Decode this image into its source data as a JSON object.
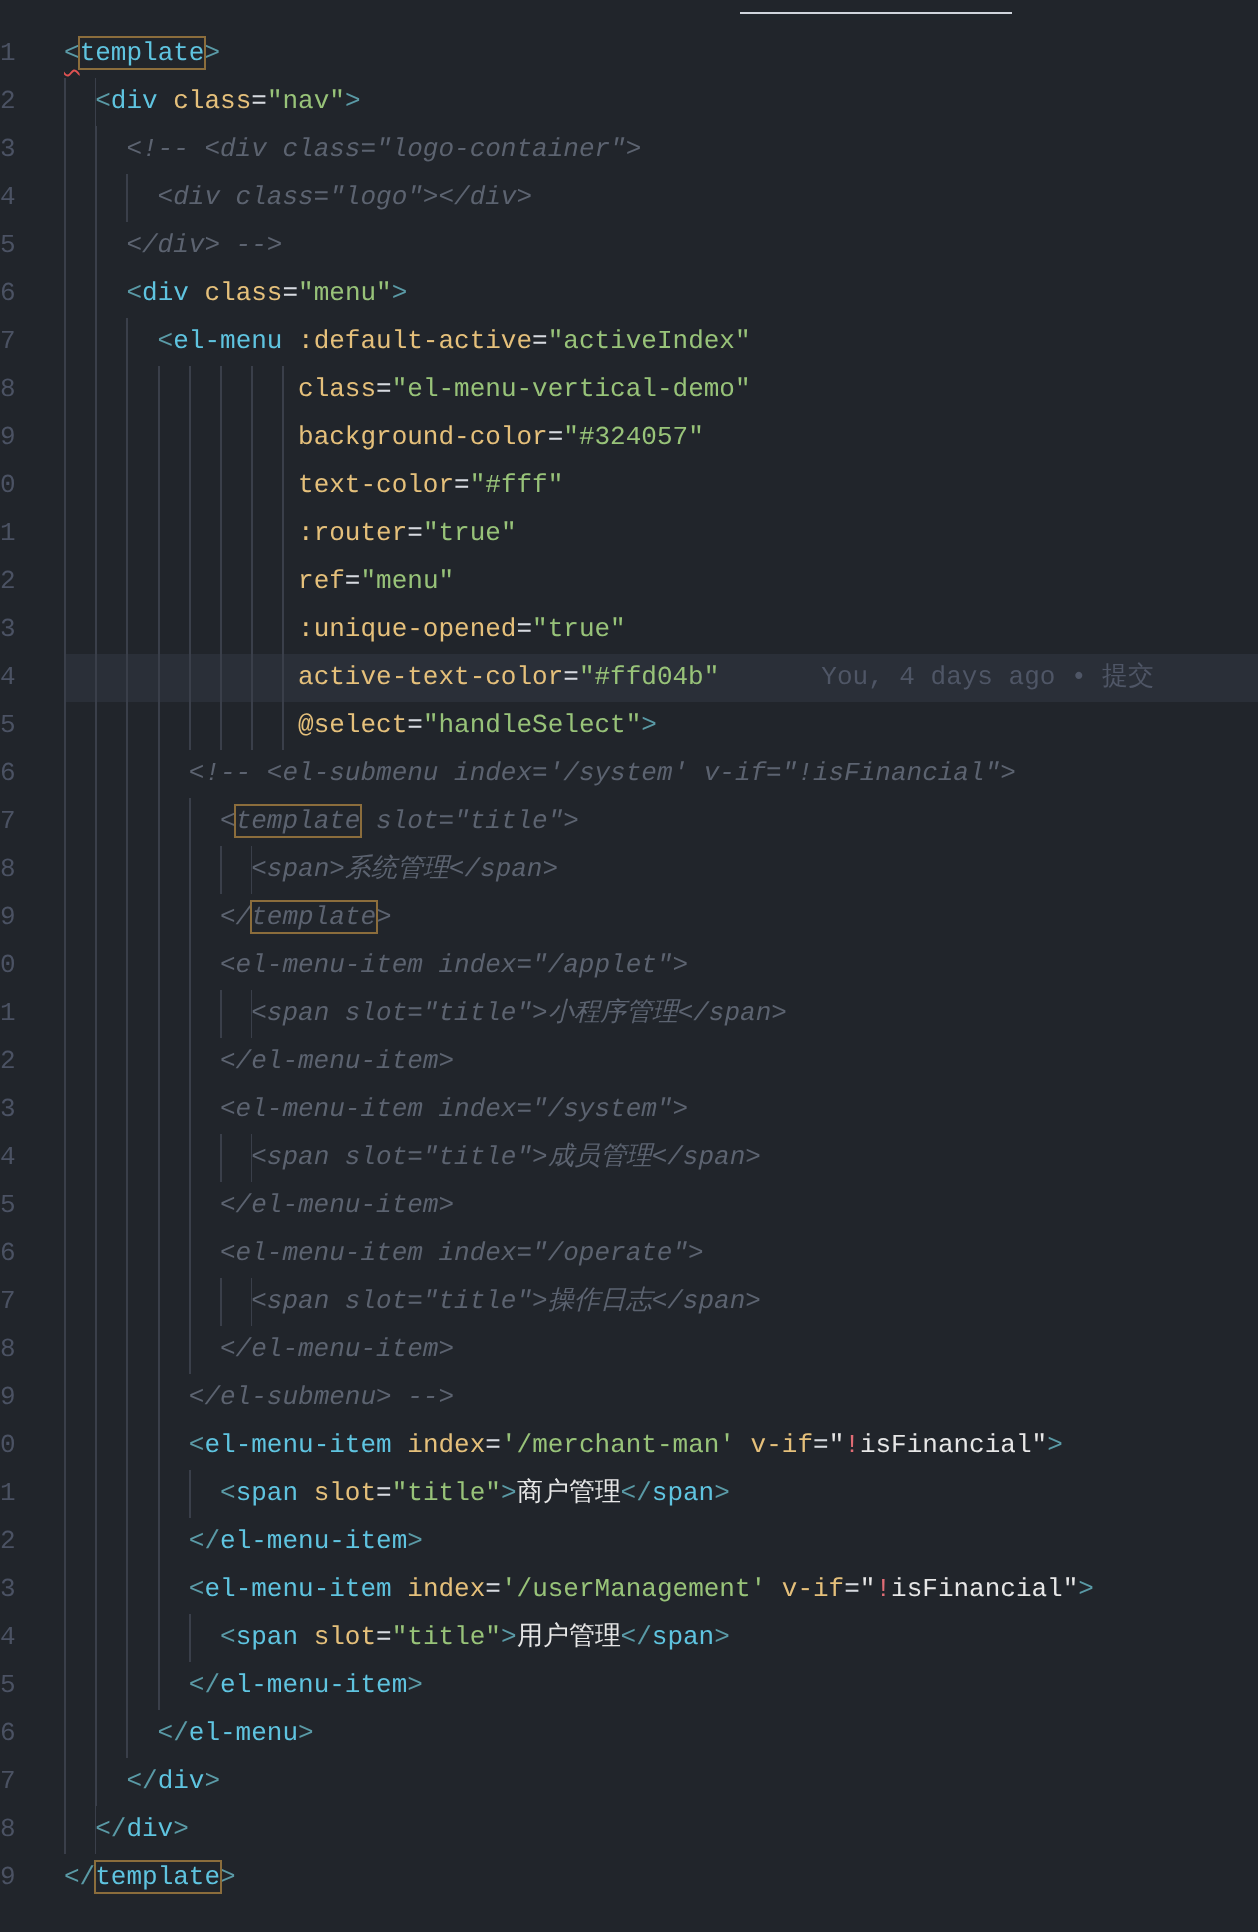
{
  "editor": {
    "lines": [
      {
        "number": "1",
        "highlighted": false,
        "tokens": [
          {
            "kind": "bracket-error",
            "text": "<"
          },
          {
            "kind": "tag-match",
            "text": "template"
          },
          {
            "kind": "bracket",
            "text": ">"
          }
        ]
      },
      {
        "number": "2",
        "highlighted": false,
        "tokens": [
          {
            "kind": "bracket",
            "text": "  <"
          },
          {
            "kind": "tag",
            "text": "div"
          },
          {
            "kind": "attr",
            "text": " class"
          },
          {
            "kind": "eq",
            "text": "="
          },
          {
            "kind": "str",
            "text": "\"nav\""
          },
          {
            "kind": "bracket",
            "text": ">"
          }
        ]
      },
      {
        "number": "3",
        "highlighted": false,
        "tokens": [
          {
            "kind": "comment",
            "text": "    <!-- <div class=\"logo-container\">"
          }
        ]
      },
      {
        "number": "4",
        "highlighted": false,
        "tokens": [
          {
            "kind": "comment",
            "text": "      <div class=\"logo\"></div>"
          }
        ]
      },
      {
        "number": "5",
        "highlighted": false,
        "tokens": [
          {
            "kind": "comment",
            "text": "    </div> -->"
          }
        ]
      },
      {
        "number": "6",
        "highlighted": false,
        "tokens": [
          {
            "kind": "bracket",
            "text": "    <"
          },
          {
            "kind": "tag",
            "text": "div"
          },
          {
            "kind": "attr",
            "text": " class"
          },
          {
            "kind": "eq",
            "text": "="
          },
          {
            "kind": "str",
            "text": "\"menu\""
          },
          {
            "kind": "bracket",
            "text": ">"
          }
        ]
      },
      {
        "number": "7",
        "highlighted": false,
        "tokens": [
          {
            "kind": "bracket",
            "text": "      <"
          },
          {
            "kind": "tag",
            "text": "el-menu"
          },
          {
            "kind": "attr",
            "text": " :default-active"
          },
          {
            "kind": "eq",
            "text": "="
          },
          {
            "kind": "str",
            "text": "\"activeIndex\""
          }
        ]
      },
      {
        "number": "8",
        "highlighted": false,
        "tokens": [
          {
            "kind": "attr",
            "text": "               class"
          },
          {
            "kind": "eq",
            "text": "="
          },
          {
            "kind": "str",
            "text": "\"el-menu-vertical-demo\""
          }
        ]
      },
      {
        "number": "9",
        "highlighted": false,
        "tokens": [
          {
            "kind": "attr",
            "text": "               background-color"
          },
          {
            "kind": "eq",
            "text": "="
          },
          {
            "kind": "str",
            "text": "\"#324057\""
          }
        ]
      },
      {
        "number": "0",
        "highlighted": false,
        "tokens": [
          {
            "kind": "attr",
            "text": "               text-color"
          },
          {
            "kind": "eq",
            "text": "="
          },
          {
            "kind": "str",
            "text": "\"#fff\""
          }
        ]
      },
      {
        "number": "1",
        "highlighted": false,
        "tokens": [
          {
            "kind": "attr",
            "text": "               :router"
          },
          {
            "kind": "eq",
            "text": "="
          },
          {
            "kind": "str",
            "text": "\"true\""
          }
        ]
      },
      {
        "number": "2",
        "highlighted": false,
        "tokens": [
          {
            "kind": "attr",
            "text": "               ref"
          },
          {
            "kind": "eq",
            "text": "="
          },
          {
            "kind": "str",
            "text": "\"menu\""
          }
        ]
      },
      {
        "number": "3",
        "highlighted": false,
        "tokens": [
          {
            "kind": "attr",
            "text": "               :unique-opened"
          },
          {
            "kind": "eq",
            "text": "="
          },
          {
            "kind": "str",
            "text": "\"true\""
          }
        ]
      },
      {
        "number": "4",
        "highlighted": true,
        "tokens": [
          {
            "kind": "attr",
            "text": "               active-text-color"
          },
          {
            "kind": "eq",
            "text": "="
          },
          {
            "kind": "str",
            "text": "\"#ffd04b\""
          }
        ],
        "blame": "You, 4 days ago • 提交"
      },
      {
        "number": "5",
        "highlighted": false,
        "tokens": [
          {
            "kind": "attr",
            "text": "               @select"
          },
          {
            "kind": "eq",
            "text": "="
          },
          {
            "kind": "str",
            "text": "\"handleSelect\""
          },
          {
            "kind": "bracket",
            "text": ">"
          }
        ]
      },
      {
        "number": "6",
        "highlighted": false,
        "tokens": [
          {
            "kind": "comment",
            "text": "        <!-- <el-submenu index='/system' v-if=\"!isFinancial\">"
          }
        ]
      },
      {
        "number": "7",
        "highlighted": false,
        "tokens": [
          {
            "kind": "comment",
            "text": "          <"
          },
          {
            "kind": "comment-match",
            "text": "template"
          },
          {
            "kind": "comment",
            "text": " slot=\"title\">"
          }
        ]
      },
      {
        "number": "8",
        "highlighted": false,
        "tokens": [
          {
            "kind": "comment",
            "text": "            <span>系统管理</span>"
          }
        ]
      },
      {
        "number": "9",
        "highlighted": false,
        "tokens": [
          {
            "kind": "comment",
            "text": "          </"
          },
          {
            "kind": "comment-match",
            "text": "template"
          },
          {
            "kind": "comment",
            "text": ">"
          }
        ]
      },
      {
        "number": "0",
        "highlighted": false,
        "tokens": [
          {
            "kind": "comment",
            "text": "          <el-menu-item index=\"/applet\">"
          }
        ]
      },
      {
        "number": "1",
        "highlighted": false,
        "tokens": [
          {
            "kind": "comment",
            "text": "            <span slot=\"title\">小程序管理</span>"
          }
        ]
      },
      {
        "number": "2",
        "highlighted": false,
        "tokens": [
          {
            "kind": "comment",
            "text": "          </el-menu-item>"
          }
        ]
      },
      {
        "number": "3",
        "highlighted": false,
        "tokens": [
          {
            "kind": "comment",
            "text": "          <el-menu-item index=\"/system\">"
          }
        ]
      },
      {
        "number": "4",
        "highlighted": false,
        "tokens": [
          {
            "kind": "comment",
            "text": "            <span slot=\"title\">成员管理</span>"
          }
        ]
      },
      {
        "number": "5",
        "highlighted": false,
        "tokens": [
          {
            "kind": "comment",
            "text": "          </el-menu-item>"
          }
        ]
      },
      {
        "number": "6",
        "highlighted": false,
        "tokens": [
          {
            "kind": "comment",
            "text": "          <el-menu-item index=\"/operate\">"
          }
        ]
      },
      {
        "number": "7",
        "highlighted": false,
        "tokens": [
          {
            "kind": "comment",
            "text": "            <span slot=\"title\">操作日志</span>"
          }
        ]
      },
      {
        "number": "8",
        "highlighted": false,
        "tokens": [
          {
            "kind": "comment",
            "text": "          </el-menu-item>"
          }
        ]
      },
      {
        "number": "9",
        "highlighted": false,
        "tokens": [
          {
            "kind": "comment",
            "text": "        </el-submenu> -->"
          }
        ]
      },
      {
        "number": "0",
        "highlighted": false,
        "tokens": [
          {
            "kind": "bracket",
            "text": "        <"
          },
          {
            "kind": "tag",
            "text": "el-menu-item"
          },
          {
            "kind": "attr",
            "text": " index"
          },
          {
            "kind": "eq",
            "text": "="
          },
          {
            "kind": "str",
            "text": "'/merchant-man'"
          },
          {
            "kind": "attr",
            "text": " v-if"
          },
          {
            "kind": "eq",
            "text": "="
          },
          {
            "kind": "text",
            "text": "\""
          },
          {
            "kind": "op",
            "text": "!"
          },
          {
            "kind": "text",
            "text": "isFinancial\""
          },
          {
            "kind": "bracket",
            "text": ">"
          }
        ]
      },
      {
        "number": "1",
        "highlighted": false,
        "tokens": [
          {
            "kind": "bracket",
            "text": "          <"
          },
          {
            "kind": "tag",
            "text": "span"
          },
          {
            "kind": "attr",
            "text": " slot"
          },
          {
            "kind": "eq",
            "text": "="
          },
          {
            "kind": "str",
            "text": "\"title\""
          },
          {
            "kind": "bracket",
            "text": ">"
          },
          {
            "kind": "text",
            "text": "商户管理"
          },
          {
            "kind": "bracket",
            "text": "</"
          },
          {
            "kind": "tag",
            "text": "span"
          },
          {
            "kind": "bracket",
            "text": ">"
          }
        ]
      },
      {
        "number": "2",
        "highlighted": false,
        "tokens": [
          {
            "kind": "bracket",
            "text": "        </"
          },
          {
            "kind": "tag",
            "text": "el-menu-item"
          },
          {
            "kind": "bracket",
            "text": ">"
          }
        ]
      },
      {
        "number": "3",
        "highlighted": false,
        "tokens": [
          {
            "kind": "bracket",
            "text": "        <"
          },
          {
            "kind": "tag",
            "text": "el-menu-item"
          },
          {
            "kind": "attr",
            "text": " index"
          },
          {
            "kind": "eq",
            "text": "="
          },
          {
            "kind": "str",
            "text": "'/userManagement'"
          },
          {
            "kind": "attr",
            "text": " v-if"
          },
          {
            "kind": "eq",
            "text": "="
          },
          {
            "kind": "text",
            "text": "\""
          },
          {
            "kind": "op",
            "text": "!"
          },
          {
            "kind": "text",
            "text": "isFinancial\""
          },
          {
            "kind": "bracket",
            "text": ">"
          }
        ]
      },
      {
        "number": "4",
        "highlighted": false,
        "tokens": [
          {
            "kind": "bracket",
            "text": "          <"
          },
          {
            "kind": "tag",
            "text": "span"
          },
          {
            "kind": "attr",
            "text": " slot"
          },
          {
            "kind": "eq",
            "text": "="
          },
          {
            "kind": "str",
            "text": "\"title\""
          },
          {
            "kind": "bracket",
            "text": ">"
          },
          {
            "kind": "text",
            "text": "用户管理"
          },
          {
            "kind": "bracket",
            "text": "</"
          },
          {
            "kind": "tag",
            "text": "span"
          },
          {
            "kind": "bracket",
            "text": ">"
          }
        ]
      },
      {
        "number": "5",
        "highlighted": false,
        "tokens": [
          {
            "kind": "bracket",
            "text": "        </"
          },
          {
            "kind": "tag",
            "text": "el-menu-item"
          },
          {
            "kind": "bracket",
            "text": ">"
          }
        ]
      },
      {
        "number": "6",
        "highlighted": false,
        "tokens": [
          {
            "kind": "bracket",
            "text": "      </"
          },
          {
            "kind": "tag",
            "text": "el-menu"
          },
          {
            "kind": "bracket",
            "text": ">"
          }
        ]
      },
      {
        "number": "7",
        "highlighted": false,
        "tokens": [
          {
            "kind": "bracket",
            "text": "    </"
          },
          {
            "kind": "tag",
            "text": "div"
          },
          {
            "kind": "bracket",
            "text": ">"
          }
        ]
      },
      {
        "number": "8",
        "highlighted": false,
        "tokens": [
          {
            "kind": "bracket",
            "text": "  </"
          },
          {
            "kind": "tag",
            "text": "div"
          },
          {
            "kind": "bracket",
            "text": ">"
          }
        ]
      },
      {
        "number": "9",
        "highlighted": false,
        "tokens": [
          {
            "kind": "bracket",
            "text": "</"
          },
          {
            "kind": "tag-match",
            "text": "template"
          },
          {
            "kind": "bracket",
            "text": ">"
          }
        ]
      }
    ]
  }
}
